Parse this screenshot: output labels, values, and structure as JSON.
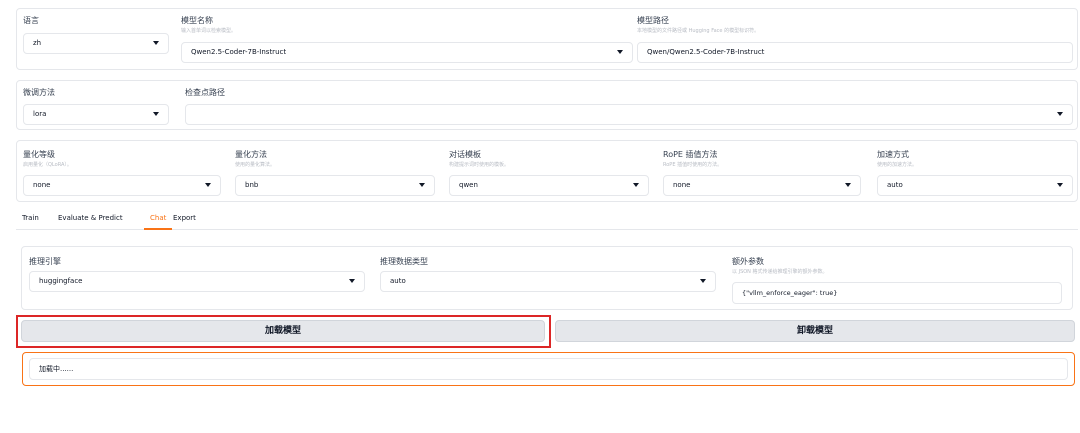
{
  "top": {
    "lang": {
      "label": "语言",
      "value": "zh"
    },
    "model_name": {
      "label": "模型名称",
      "hint": "输入首单词以检索模型。",
      "value": "Qwen2.5-Coder-7B-Instruct"
    },
    "model_path": {
      "label": "模型路径",
      "hint": "本地模型的文件路径或 Hugging Face 的模型标识符。",
      "value": "Qwen/Qwen2.5-Coder-7B-Instruct"
    }
  },
  "finetune": {
    "method": {
      "label": "微调方法",
      "value": "lora"
    },
    "checkpoint": {
      "label": "检查点路径",
      "value": ""
    }
  },
  "quant": {
    "bit": {
      "label": "量化等级",
      "hint": "启用量化（QLoRA）。",
      "value": "none"
    },
    "method": {
      "label": "量化方法",
      "hint": "使用的量化算法。",
      "value": "bnb"
    },
    "template": {
      "label": "对话模板",
      "hint": "构建提示词时使用的模板。",
      "value": "qwen"
    },
    "rope": {
      "label": "RoPE 插值方法",
      "hint": "RoPE 插值时使用的方法。",
      "value": "none"
    },
    "booster": {
      "label": "加速方式",
      "hint": "使用的加速方法。",
      "value": "auto"
    }
  },
  "tabs": [
    "Train",
    "Evaluate & Predict",
    "Chat",
    "Export"
  ],
  "active_tab": "Chat",
  "chat": {
    "backend": {
      "label": "推理引擎",
      "value": "huggingface"
    },
    "dtype": {
      "label": "推理数据类型",
      "value": "auto"
    },
    "extra": {
      "label": "额外参数",
      "hint": "以 JSON 格式传递给推理引擎的额外参数。",
      "value": "{\"vllm_enforce_eager\": true}"
    },
    "load_label": "加载模型",
    "unload_label": "卸载模型",
    "info_text": "加载中......"
  },
  "colors": {
    "accent": "#f97316",
    "highlight": "#dc2626"
  }
}
